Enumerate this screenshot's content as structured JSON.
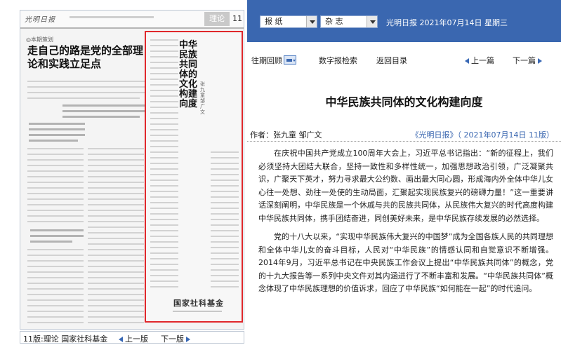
{
  "colors": {
    "toolbar_bg": "#3a67b0",
    "highlight_border": "#e0282c",
    "link": "#3a67b0"
  },
  "toolbar": {
    "select_paper": "报 纸",
    "select_magazine": "杂 志",
    "date_line": "光明日报 2021年07月14日 星期三"
  },
  "nav": {
    "history": "往期回顾",
    "search": "数字报检索",
    "catalog": "返回目录",
    "prev": "上一篇",
    "next": "下一篇"
  },
  "paper_preview": {
    "logo": "光明日报",
    "section": "理论",
    "page": "11",
    "headline_tag": "◎本期策划",
    "headline": "走自己的路是党的全部理论和实践立足点",
    "vertical_title": "中华民族共同体的文化构建向度",
    "vertical_author": "张九童 邹广文",
    "fund_logo": "国家社科基金"
  },
  "page_footer": {
    "title": "11版:理论 国家社科基金",
    "prev": "上一版",
    "next": "下一版"
  },
  "article": {
    "title": "中华民族共同体的文化构建向度",
    "author": "作者：张九童  邹广文",
    "source": "《光明日报》（ 2021年07月14日  11版）",
    "paragraphs": [
      "在庆祝中国共产党成立100周年大会上，习近平总书记指出：“新的征程上，我们必须坚持大团结大联合，坚持一致性和多样性统一，加强思想政治引领，广泛凝聚共识，广聚天下英才，努力寻求最大公约数、画出最大同心圆，形成海内外全体中华儿女心往一处想、劲往一处使的生动局面，汇聚起实现民族复兴的磅礴力量！”这一重要讲话深刻阐明，中华民族是一个休戚与共的民族共同体，从民族伟大复兴的时代高度构建中华民族共同体，携手团结奋进，同创美好未来，是中华民族存续发展的必然选择。",
      "党的十八大以来，“实现中华民族伟大复兴的中国梦”成为全国各族人民的共同理想和全体中华儿女的奋斗目标，人民对“中华民族”的情感认同和自觉意识不断增强。2014年9月，习近平总书记在中央民族工作会议上提出“中华民族共同体”的概念，党的十九大报告等一系列中央文件对其内涵进行了不断丰富和发展。“中华民族共同体”概念体现了中华民族理想的价值诉求，回应了中华民族“如何能在一起”的时代追问。"
    ]
  }
}
